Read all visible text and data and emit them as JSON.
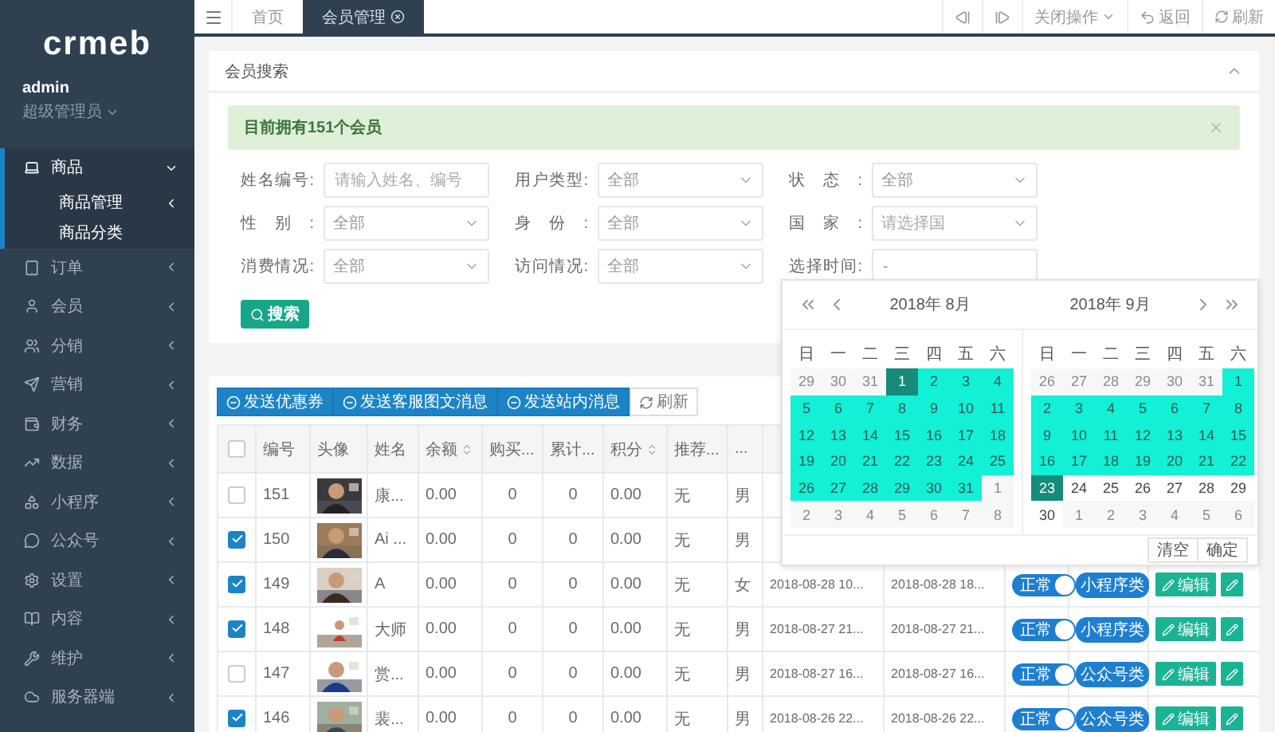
{
  "sidebar": {
    "logo": "crmeb",
    "user": {
      "name": "admin",
      "role": "超级管理员"
    },
    "menu": [
      {
        "label": "商品",
        "selected": true,
        "expanded": true,
        "children": [
          {
            "label": "商品管理",
            "expandable": true
          },
          {
            "label": "商品分类",
            "expandable": false
          }
        ]
      },
      {
        "label": "订单",
        "selected": false,
        "expanded": false
      },
      {
        "label": "会员",
        "selected": false,
        "expanded": false
      },
      {
        "label": "分销",
        "selected": false,
        "expanded": false
      },
      {
        "label": "营销",
        "selected": false,
        "expanded": false
      },
      {
        "label": "财务",
        "selected": false,
        "expanded": false
      },
      {
        "label": "数据",
        "selected": false,
        "expanded": false
      },
      {
        "label": "小程序",
        "selected": false,
        "expanded": false
      },
      {
        "label": "公众号",
        "selected": false,
        "expanded": false
      },
      {
        "label": "设置",
        "selected": false,
        "expanded": false
      },
      {
        "label": "内容",
        "selected": false,
        "expanded": false
      },
      {
        "label": "维护",
        "selected": false,
        "expanded": false
      },
      {
        "label": "服务器端",
        "selected": false,
        "expanded": false
      }
    ]
  },
  "topbar": {
    "tabs": [
      {
        "label": "首页",
        "selected": false
      },
      {
        "label": "会员管理",
        "selected": true
      }
    ],
    "actions": [
      {
        "kind": "prev"
      },
      {
        "kind": "next"
      },
      {
        "kind": "dropdown",
        "label": "关闭操作"
      },
      {
        "kind": "back",
        "label": "返回"
      },
      {
        "kind": "refresh",
        "label": "刷新"
      }
    ]
  },
  "search": {
    "title": "会员搜索",
    "alert": "目前拥有151个会员",
    "fields": [
      {
        "label": "姓名编号:",
        "kind": "text",
        "placeholder": "请输入姓名、编号"
      },
      {
        "label": "用户类型:",
        "kind": "select",
        "value": "全部"
      },
      {
        "label": "状态:",
        "kind": "select",
        "value": "全部"
      },
      {
        "label": "性别:",
        "kind": "select",
        "value": "全部"
      },
      {
        "label": "身份:",
        "kind": "select",
        "value": "全部"
      },
      {
        "label": "国家:",
        "kind": "select",
        "placeholder": "请选择国"
      },
      {
        "label": "消费情况:",
        "kind": "select",
        "value": "全部"
      },
      {
        "label": "访问情况:",
        "kind": "select",
        "value": "全部"
      },
      {
        "label": "选择时间:",
        "kind": "text",
        "value": "-"
      }
    ],
    "button": "搜索"
  },
  "table": {
    "toolbar": [
      {
        "label": "发送优惠券",
        "kind": "primary"
      },
      {
        "label": "发送客服图文消息",
        "kind": "primary"
      },
      {
        "label": "发送站内消息",
        "kind": "primary"
      },
      {
        "label": "刷新",
        "kind": "default"
      }
    ],
    "header_checked": false,
    "columns": [
      {
        "label": "编号",
        "sortable": false
      },
      {
        "label": "头像",
        "sortable": false
      },
      {
        "label": "姓名",
        "sortable": false
      },
      {
        "label": "余额",
        "sortable": true
      },
      {
        "label": "购买...",
        "sortable": false
      },
      {
        "label": "累计...",
        "sortable": false
      },
      {
        "label": "积分",
        "sortable": true
      },
      {
        "label": "推荐...",
        "sortable": false
      },
      {
        "label": "...",
        "sortable": false
      }
    ],
    "rows": [
      {
        "checked": false,
        "id": "151",
        "name": "康...",
        "balance": "0.00",
        "purchases": "0",
        "total": "0",
        "points": "0.00",
        "referrer": "无",
        "gender": "男"
      },
      {
        "checked": true,
        "id": "150",
        "name": "Ai ...",
        "balance": "0.00",
        "purchases": "0",
        "total": "0",
        "points": "0.00",
        "referrer": "无",
        "gender": "男"
      },
      {
        "checked": true,
        "id": "149",
        "name": "A",
        "balance": "0.00",
        "purchases": "0",
        "total": "0",
        "points": "0.00",
        "referrer": "无",
        "gender": "女",
        "first_visit": "2018-08-28 10...",
        "last_visit": "2018-08-28 18...",
        "status": "正常",
        "status_on": true,
        "type": "小程序类",
        "edit": "编辑"
      },
      {
        "checked": true,
        "id": "148",
        "name": "大师",
        "balance": "0.00",
        "purchases": "0",
        "total": "0",
        "points": "0.00",
        "referrer": "无",
        "gender": "男",
        "first_visit": "2018-08-27 21...",
        "last_visit": "2018-08-27 21...",
        "status": "正常",
        "status_on": true,
        "type": "小程序类",
        "edit": "编辑"
      },
      {
        "checked": false,
        "id": "147",
        "name": "赏...",
        "balance": "0.00",
        "purchases": "0",
        "total": "0",
        "points": "0.00",
        "referrer": "无",
        "gender": "男",
        "first_visit": "2018-08-27 16...",
        "last_visit": "2018-08-27 16...",
        "status": "正常",
        "status_on": true,
        "type": "公众号类",
        "edit": "编辑"
      },
      {
        "checked": true,
        "id": "146",
        "name": "裴...",
        "balance": "0.00",
        "purchases": "0",
        "total": "0",
        "points": "0.00",
        "referrer": "无",
        "gender": "男",
        "first_visit": "2018-08-26 22...",
        "last_visit": "2018-08-26 22...",
        "status": "正常",
        "status_on": true,
        "type": "公众号类",
        "edit": "编辑"
      }
    ]
  },
  "calendar": {
    "months": [
      {
        "title": "2018年 8月",
        "weekdays": [
          "日",
          "一",
          "二",
          "三",
          "四",
          "五",
          "六"
        ],
        "weeks": [
          [
            {
              "d": "29",
              "kind": "other"
            },
            {
              "d": "30",
              "kind": "other"
            },
            {
              "d": "31",
              "kind": "other"
            },
            {
              "d": "1",
              "kind": "endpoint"
            },
            {
              "d": "2",
              "kind": "range"
            },
            {
              "d": "3",
              "kind": "range"
            },
            {
              "d": "4",
              "kind": "range"
            }
          ],
          [
            {
              "d": "5",
              "kind": "range"
            },
            {
              "d": "6",
              "kind": "range"
            },
            {
              "d": "7",
              "kind": "range"
            },
            {
              "d": "8",
              "kind": "range"
            },
            {
              "d": "9",
              "kind": "range"
            },
            {
              "d": "10",
              "kind": "range"
            },
            {
              "d": "11",
              "kind": "range"
            }
          ],
          [
            {
              "d": "12",
              "kind": "range"
            },
            {
              "d": "13",
              "kind": "range"
            },
            {
              "d": "14",
              "kind": "range"
            },
            {
              "d": "15",
              "kind": "range"
            },
            {
              "d": "16",
              "kind": "range"
            },
            {
              "d": "17",
              "kind": "range"
            },
            {
              "d": "18",
              "kind": "range"
            }
          ],
          [
            {
              "d": "19",
              "kind": "range"
            },
            {
              "d": "20",
              "kind": "range"
            },
            {
              "d": "21",
              "kind": "range"
            },
            {
              "d": "22",
              "kind": "range"
            },
            {
              "d": "23",
              "kind": "range"
            },
            {
              "d": "24",
              "kind": "range"
            },
            {
              "d": "25",
              "kind": "range"
            }
          ],
          [
            {
              "d": "26",
              "kind": "range"
            },
            {
              "d": "27",
              "kind": "range"
            },
            {
              "d": "28",
              "kind": "range"
            },
            {
              "d": "29",
              "kind": "range"
            },
            {
              "d": "30",
              "kind": "range"
            },
            {
              "d": "31",
              "kind": "range"
            },
            {
              "d": "1",
              "kind": "other"
            }
          ],
          [
            {
              "d": "2",
              "kind": "other"
            },
            {
              "d": "3",
              "kind": "other"
            },
            {
              "d": "4",
              "kind": "other"
            },
            {
              "d": "5",
              "kind": "other"
            },
            {
              "d": "6",
              "kind": "other"
            },
            {
              "d": "7",
              "kind": "other"
            },
            {
              "d": "8",
              "kind": "other"
            }
          ]
        ]
      },
      {
        "title": "2018年 9月",
        "weekdays": [
          "日",
          "一",
          "二",
          "三",
          "四",
          "五",
          "六"
        ],
        "weeks": [
          [
            {
              "d": "26",
              "kind": "other"
            },
            {
              "d": "27",
              "kind": "other"
            },
            {
              "d": "28",
              "kind": "other"
            },
            {
              "d": "29",
              "kind": "other"
            },
            {
              "d": "30",
              "kind": "other"
            },
            {
              "d": "31",
              "kind": "other"
            },
            {
              "d": "1",
              "kind": "range"
            }
          ],
          [
            {
              "d": "2",
              "kind": "range"
            },
            {
              "d": "3",
              "kind": "range"
            },
            {
              "d": "4",
              "kind": "range"
            },
            {
              "d": "5",
              "kind": "range"
            },
            {
              "d": "6",
              "kind": "range"
            },
            {
              "d": "7",
              "kind": "range"
            },
            {
              "d": "8",
              "kind": "range"
            }
          ],
          [
            {
              "d": "9",
              "kind": "range"
            },
            {
              "d": "10",
              "kind": "range"
            },
            {
              "d": "11",
              "kind": "range"
            },
            {
              "d": "12",
              "kind": "range"
            },
            {
              "d": "13",
              "kind": "range"
            },
            {
              "d": "14",
              "kind": "range"
            },
            {
              "d": "15",
              "kind": "range"
            }
          ],
          [
            {
              "d": "16",
              "kind": "range"
            },
            {
              "d": "17",
              "kind": "range"
            },
            {
              "d": "18",
              "kind": "range"
            },
            {
              "d": "19",
              "kind": "range"
            },
            {
              "d": "20",
              "kind": "range"
            },
            {
              "d": "21",
              "kind": "range"
            },
            {
              "d": "22",
              "kind": "range"
            }
          ],
          [
            {
              "d": "23",
              "kind": "endpoint"
            },
            {
              "d": "24",
              "kind": "day"
            },
            {
              "d": "25",
              "kind": "day"
            },
            {
              "d": "26",
              "kind": "day"
            },
            {
              "d": "27",
              "kind": "day"
            },
            {
              "d": "28",
              "kind": "day"
            },
            {
              "d": "29",
              "kind": "day"
            }
          ],
          [
            {
              "d": "30",
              "kind": "day"
            },
            {
              "d": "1",
              "kind": "other"
            },
            {
              "d": "2",
              "kind": "other"
            },
            {
              "d": "3",
              "kind": "other"
            },
            {
              "d": "4",
              "kind": "other"
            },
            {
              "d": "5",
              "kind": "other"
            },
            {
              "d": "6",
              "kind": "other"
            }
          ]
        ]
      }
    ],
    "buttons": [
      "清空",
      "确定"
    ]
  }
}
